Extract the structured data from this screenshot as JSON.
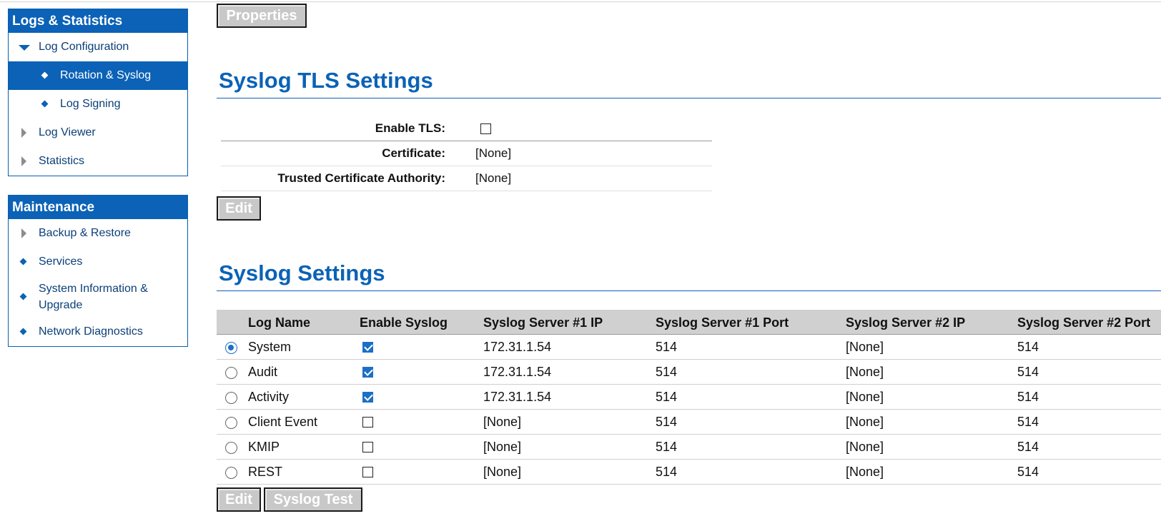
{
  "top_button": {
    "label": "Properties"
  },
  "sidebar": {
    "logs_panel": {
      "title": "Logs & Statistics",
      "items": [
        {
          "label": "Log Configuration"
        },
        {
          "label": "Rotation & Syslog"
        },
        {
          "label": "Log Signing"
        },
        {
          "label": "Log Viewer"
        },
        {
          "label": "Statistics"
        }
      ]
    },
    "maintenance_panel": {
      "title": "Maintenance",
      "items": [
        {
          "label": "Backup & Restore"
        },
        {
          "label": "Services"
        },
        {
          "label": "System Information & Upgrade"
        },
        {
          "label": "Network Diagnostics"
        }
      ]
    }
  },
  "tls": {
    "title": "Syslog TLS Settings",
    "enable_label": "Enable TLS:",
    "enable_value": false,
    "certificate_label": "Certificate:",
    "certificate_value": "[None]",
    "ca_label": "Trusted Certificate Authority:",
    "ca_value": "[None]",
    "edit_label": "Edit"
  },
  "syslog": {
    "title": "Syslog Settings",
    "columns": [
      "Log Name",
      "Enable Syslog",
      "Syslog Server #1 IP",
      "Syslog Server #1 Port",
      "Syslog Server #2 IP",
      "Syslog Server #2 Port"
    ],
    "rows": [
      {
        "name": "System",
        "selected": true,
        "enabled": true,
        "ip1": "172.31.1.54",
        "port1": "514",
        "ip2": "[None]",
        "port2": "514"
      },
      {
        "name": "Audit",
        "selected": false,
        "enabled": true,
        "ip1": "172.31.1.54",
        "port1": "514",
        "ip2": "[None]",
        "port2": "514"
      },
      {
        "name": "Activity",
        "selected": false,
        "enabled": true,
        "ip1": "172.31.1.54",
        "port1": "514",
        "ip2": "[None]",
        "port2": "514"
      },
      {
        "name": "Client Event",
        "selected": false,
        "enabled": false,
        "ip1": "[None]",
        "port1": "514",
        "ip2": "[None]",
        "port2": "514"
      },
      {
        "name": "KMIP",
        "selected": false,
        "enabled": false,
        "ip1": "[None]",
        "port1": "514",
        "ip2": "[None]",
        "port2": "514"
      },
      {
        "name": "REST",
        "selected": false,
        "enabled": false,
        "ip1": "[None]",
        "port1": "514",
        "ip2": "[None]",
        "port2": "514"
      }
    ],
    "edit_label": "Edit",
    "test_label": "Syslog Test"
  }
}
